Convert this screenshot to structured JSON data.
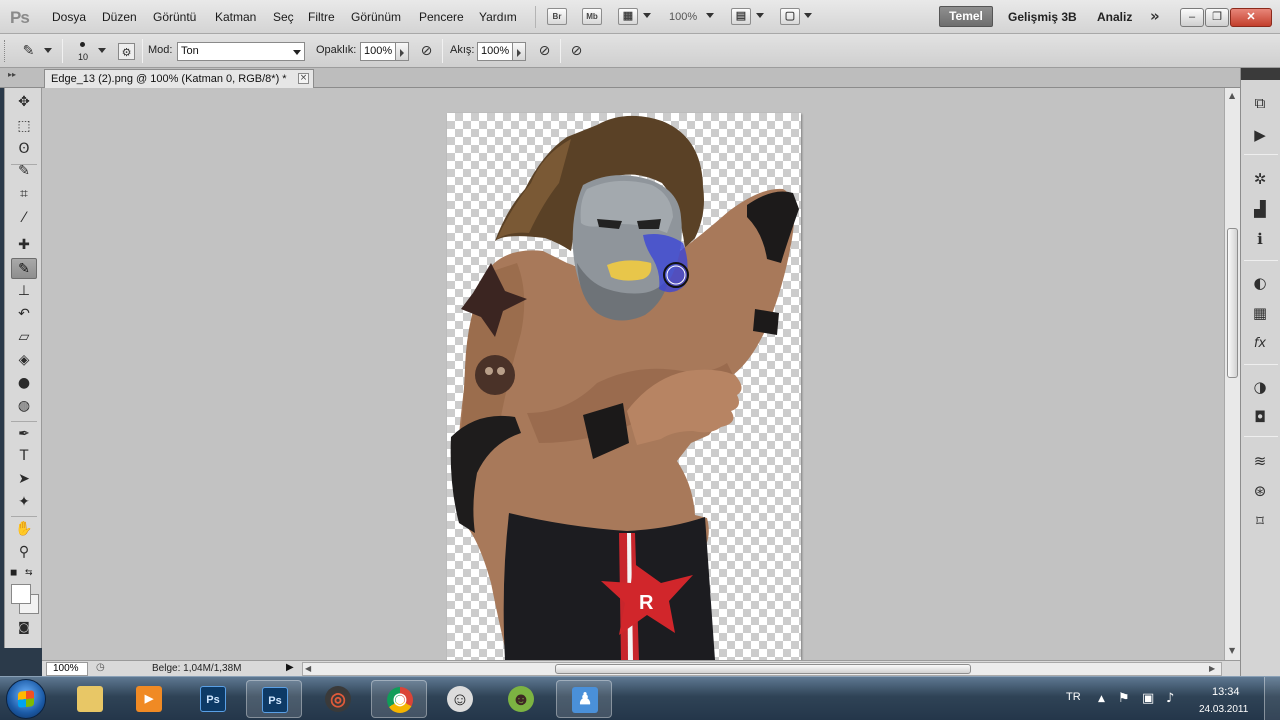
{
  "app": {
    "logo": "Ps"
  },
  "menu": [
    "Dosya",
    "Düzen",
    "Görüntü",
    "Katman",
    "Seç",
    "Filtre",
    "Görünüm",
    "Pencere",
    "Yardım"
  ],
  "app_bar": {
    "bridge": "Br",
    "mini_bridge": "Mb",
    "zoom": "100%"
  },
  "workspaces": {
    "active": "Temel",
    "others": [
      "Gelişmiş 3B",
      "Analiz"
    ],
    "more": "»"
  },
  "window_buttons": {
    "minimize": "–",
    "restore": "❐",
    "close": "✕"
  },
  "options": {
    "brush_size": "10",
    "mode_label": "Mod:",
    "mode_value": "Ton",
    "opacity_label": "Opaklık:",
    "opacity_value": "100%",
    "flow_label": "Akış:",
    "flow_value": "100%"
  },
  "document": {
    "tab_title": "Edge_13 (2).png @ 100% (Katman 0, RGB/8*) *",
    "close": "×"
  },
  "status": {
    "zoom": "100%",
    "doc_size": "Belge: 1,04M/1,38M"
  },
  "toolbox": {
    "tools": [
      {
        "name": "move-tool",
        "glyph": "✥"
      },
      {
        "name": "marquee-tool",
        "glyph": "⬚"
      },
      {
        "name": "lasso-tool",
        "glyph": "ʘ"
      },
      {
        "name": "quick-selection-tool",
        "glyph": "✎"
      },
      {
        "name": "crop-tool",
        "glyph": "⌗"
      },
      {
        "name": "eyedropper-tool",
        "glyph": "⁄"
      },
      {
        "name": "healing-brush-tool",
        "glyph": "✚"
      },
      {
        "name": "brush-tool",
        "glyph": "✎"
      },
      {
        "name": "clone-stamp-tool",
        "glyph": "⊥"
      },
      {
        "name": "history-brush-tool",
        "glyph": "↶"
      },
      {
        "name": "eraser-tool",
        "glyph": "▱"
      },
      {
        "name": "paint-bucket-tool",
        "glyph": "◈"
      },
      {
        "name": "blur-tool",
        "glyph": "●"
      },
      {
        "name": "dodge-tool",
        "glyph": "◍"
      },
      {
        "name": "pen-tool",
        "glyph": "✒"
      },
      {
        "name": "type-tool",
        "glyph": "T"
      },
      {
        "name": "path-selection-tool",
        "glyph": "➤"
      },
      {
        "name": "shape-tool",
        "glyph": "✦"
      },
      {
        "name": "hand-tool",
        "glyph": "✋"
      },
      {
        "name": "zoom-tool",
        "glyph": "⚲"
      }
    ],
    "colors": {
      "foreground": "#ffffff",
      "background": "#f2f2f2"
    }
  },
  "dock_icons": [
    {
      "name": "history-icon",
      "glyph": "⧉"
    },
    {
      "name": "actions-icon",
      "glyph": "▶"
    },
    {
      "name": "navigator-icon",
      "glyph": "✲"
    },
    {
      "name": "histogram-icon",
      "glyph": "▟"
    },
    {
      "name": "info-icon",
      "glyph": "ℹ"
    },
    {
      "name": "color-icon",
      "glyph": "◐"
    },
    {
      "name": "swatches-icon",
      "glyph": "▦"
    },
    {
      "name": "styles-icon",
      "glyph": "fx"
    },
    {
      "name": "adjustments-icon",
      "glyph": "◑"
    },
    {
      "name": "masks-icon",
      "glyph": "◘"
    },
    {
      "name": "layers-icon",
      "glyph": "≋"
    },
    {
      "name": "channels-icon",
      "glyph": "⊛"
    },
    {
      "name": "paths-icon",
      "glyph": "⌑"
    }
  ],
  "taskbar": {
    "apps": [
      {
        "name": "explorer",
        "label": "",
        "color": "#e8c766"
      },
      {
        "name": "media-player",
        "label": "▶",
        "color": "#f08a24"
      },
      {
        "name": "photoshop-pinned",
        "label": "Ps",
        "color": "#0d3a66"
      },
      {
        "name": "photoshop-active",
        "label": "Ps",
        "color": "#0d3a66"
      },
      {
        "name": "record-app",
        "label": "◎",
        "color": "#c0392b"
      },
      {
        "name": "chrome",
        "label": "◉",
        "color": "#3c8d3c"
      },
      {
        "name": "messenger-1",
        "label": "☺",
        "color": "#dcdcdc"
      },
      {
        "name": "messenger-2",
        "label": "☻",
        "color": "#7cb342"
      },
      {
        "name": "live-messenger",
        "label": "♟",
        "color": "#4a90d9"
      }
    ],
    "language": "TR",
    "time": "13:34",
    "date": "24.03.2011"
  }
}
